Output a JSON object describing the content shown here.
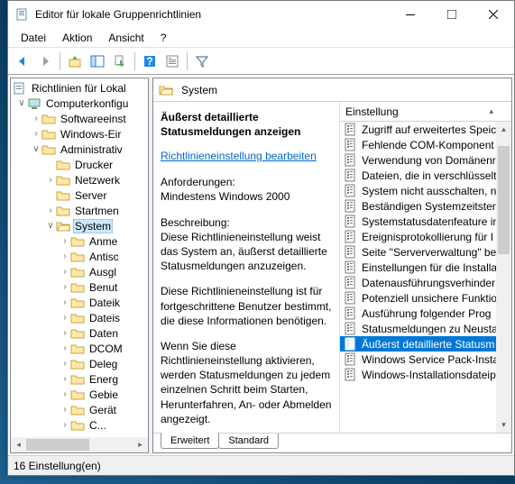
{
  "window": {
    "title": "Editor für lokale Gruppenrichtlinien"
  },
  "menu": {
    "file": "Datei",
    "action": "Aktion",
    "view": "Ansicht",
    "help": "?"
  },
  "tree": {
    "root": "Richtlinien für Lokal",
    "computer": "Computerkonfigu",
    "software": "Softwareeinst",
    "windows": "Windows-Eir",
    "admin": "Administrativ",
    "printer": "Drucker",
    "network": "Netzwerk",
    "server": "Server",
    "startmenu": "Startmen",
    "system": "System",
    "children": [
      "Anme",
      "Antisc",
      "Ausgl",
      "Benut",
      "Dateik",
      "Dateis",
      "Daten",
      "DCOM",
      "Deleg",
      "Energ",
      "Gebie",
      "Gerät",
      "C..."
    ]
  },
  "right": {
    "heading": "System",
    "detail": {
      "title": "Äußerst detaillierte Statusmeldungen anzeigen",
      "edit_link": "Richtlinieneinstellung bearbeiten",
      "req_label": "Anforderungen:",
      "req_text": "Mindestens Windows 2000",
      "desc_label": "Beschreibung:",
      "desc1": "Diese Richtlinieneinstellung weist das System an, äußerst detaillierte Statusmeldungen anzuzeigen.",
      "desc2": "Diese Richtlinieneinstellung ist für fortgeschrittene Benutzer bestimmt, die diese Informationen benötigen.",
      "desc3": "Wenn Sie diese Richtlinieneinstellung aktivieren, werden Statusmeldungen zu jedem einzelnen Schritt beim Starten, Herunterfahren, An- oder Abmelden angezeigt."
    },
    "list_header": "Einstellung",
    "items": [
      "Zugriff auf erweitertes Speic",
      "Fehlende COM-Komponent",
      "Verwendung von Domänenr",
      "Dateien, die in verschlüsselt",
      "System nicht ausschalten, n",
      "Beständigen Systemzeitsten",
      "Systemstatusdatenfeature in",
      "Ereignisprotokollierung für I",
      "Seite \"Serververwaltung\" be",
      "Einstellungen für die Installa",
      "Datenausführungsverhinder",
      "Potenziell unsichere Funktio",
      "Ausführung folgender Prog",
      "Statusmeldungen zu Neusta",
      "Äußerst detaillierte Statusm",
      "Windows Service Pack-Insta",
      "Windows-Installationsdateip"
    ],
    "selected_index": 14
  },
  "tabs": {
    "extended": "Erweitert",
    "standard": "Standard"
  },
  "status": "16 Einstellung(en)"
}
